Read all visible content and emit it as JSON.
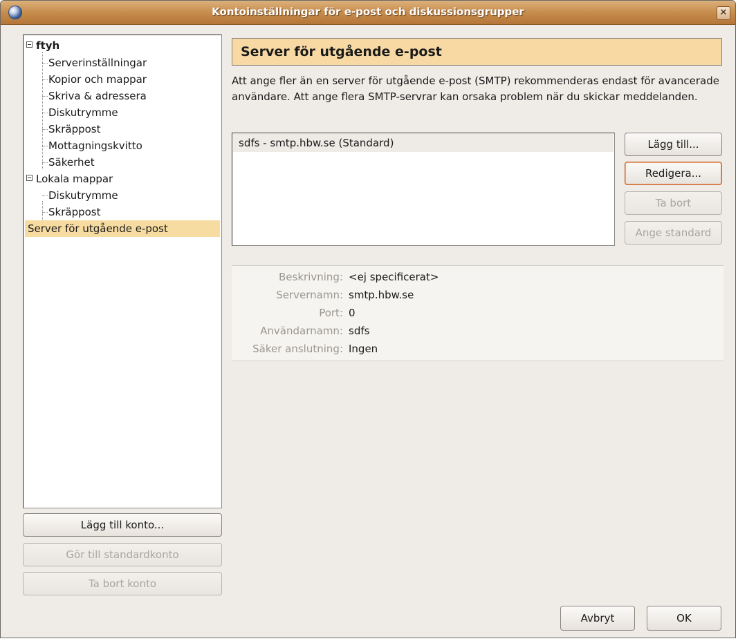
{
  "window": {
    "title": "Kontoinställningar för e-post och diskussionsgrupper",
    "close_glyph": "✕"
  },
  "tree": {
    "account": "ftyh",
    "account_items": [
      "Serverinställningar",
      "Kopior och mappar",
      "Skriva & adressera",
      "Diskutrymme",
      "Skräppost",
      "Mottagningskvitto",
      "Säkerhet"
    ],
    "local": "Lokala mappar",
    "local_items": [
      "Diskutrymme",
      "Skräppost"
    ],
    "outgoing": "Server för utgående e-post"
  },
  "account_buttons": {
    "add": "Lägg till konto...",
    "set_default": "Gör till standardkonto",
    "remove": "Ta bort konto"
  },
  "page": {
    "title": "Server för utgående e-post",
    "description": "Att ange fler än en server för utgående e-post (SMTP) rekommenderas endast för avancerade användare. Att ange flera SMTP-servrar kan orsaka problem när du skickar meddelanden.",
    "servers": [
      "sdfs - smtp.hbw.se (Standard)"
    ],
    "buttons": {
      "add": "Lägg till...",
      "edit": "Redigera...",
      "remove": "Ta bort",
      "set_default": "Ange standard"
    },
    "details": [
      {
        "label": "Beskrivning:",
        "value": "<ej specificerat>"
      },
      {
        "label": "Servernamn:",
        "value": "smtp.hbw.se"
      },
      {
        "label": "Port:",
        "value": "0"
      },
      {
        "label": "Användarnamn:",
        "value": "sdfs"
      },
      {
        "label": "Säker anslutning:",
        "value": "Ingen"
      }
    ]
  },
  "dialog_buttons": {
    "cancel": "Avbryt",
    "ok": "OK"
  },
  "colors": {
    "titlebar": "#c58a49",
    "selection": "#f7dca2",
    "header": "#f8d9a3"
  }
}
